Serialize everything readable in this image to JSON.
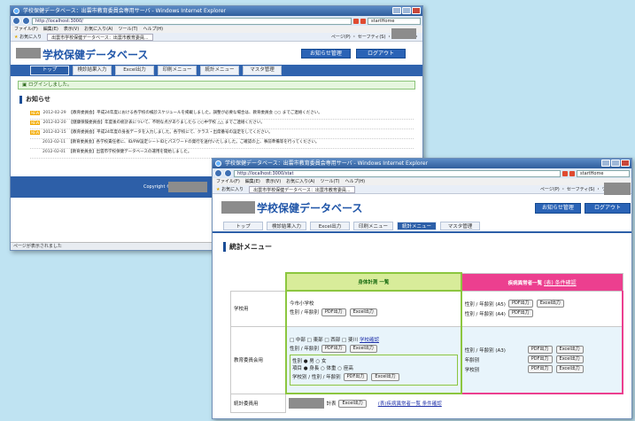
{
  "window1": {
    "title": "学校保健データベース：出雲市教育委員会専用サーバ - Windows Internet Explorer",
    "url": "http://localhost:3000/",
    "search_placeholder": "startHome",
    "menu": [
      "ファイル(F)",
      "編集(E)",
      "表示(V)",
      "お気に入り(A)",
      "ツール(T)",
      "ヘルプ(H)"
    ],
    "fav_label": "お気に入り",
    "fav_tab": "出雲市学校保健データベース：出雲市教育委員...",
    "toolbar_right": "ページ(P) ・ セーフティ(S) ・ ツール(O) ・",
    "site_title": "学校保健データベース",
    "header_buttons": [
      "お知らせ管理",
      "ログアウト"
    ],
    "nav_tabs": [
      "トップ",
      "検診結果入力",
      "Excel出力",
      "印刷メニュー",
      "統計メニュー",
      "マスタ管理"
    ],
    "login_message": "ログインしました。",
    "news_heading": "お知らせ",
    "news": [
      {
        "date": "2012-02-29",
        "text": "【教育委員会】平成24年度における各学校の検診スケジュールを掲載しました。調整が必要な場合は、教育委員会 ○○ までご連絡ください。"
      },
      {
        "date": "2012-02-20",
        "text": "【健康保険委員会】年度後の統計表について、不明な点がありましたら ○○中学校 △△ までご連絡ください。"
      },
      {
        "date": "2012-02-15",
        "text": "【教育委員会】平成24年度の身長データを入力しました。各学校にて、クラス・出席番号の設定をしてください。"
      },
      {
        "date": "2012-02-11",
        "text": "【教育委員会】各学校責任者に、ID/PW設定シートIDとパスワードの発行を送付いたしました。ご確認の上、事前準備等を行ってください。"
      },
      {
        "date": "2012-02-01",
        "text": "【教育委員会】出雲市学校保健データベースの運用を開始しました。"
      }
    ],
    "footer_copyright": "Copyright ©",
    "status_text": "ページが表示されました"
  },
  "window2": {
    "title": "学校保健データベース：出雲市教育委員会専用サーバ - Windows Internet Explorer",
    "url": "http://localhost:3000/stat",
    "search_placeholder": "startHome",
    "menu": [
      "ファイル(F)",
      "編集(E)",
      "表示(V)",
      "お気に入り(A)",
      "ツール(T)",
      "ヘルプ(H)"
    ],
    "fav_label": "お気に入り",
    "fav_tab": "出雲市学校保健データベース：出雲市教育委員...",
    "toolbar_right": "ページ(P) ・ セーフティ(S) ・ ツール(O) ・",
    "site_title": "学校保健データベース",
    "header_buttons": [
      "お知らせ管理",
      "ログアウト"
    ],
    "nav_tabs": [
      "トップ",
      "検診結果入力",
      "Excel出力",
      "印刷メニュー",
      "統計メニュー",
      "マスタ管理"
    ],
    "section_heading": "統計メニュー",
    "col_body": "身体計測 一覧",
    "col_disease": "疾病異常者一覧",
    "col_disease_link": "(表) 条件確認",
    "rows": {
      "school_label": "学校用",
      "school_name": "今市小学校",
      "board_label": "教育委員会用",
      "committee_label": "統計委員用"
    },
    "labels": {
      "sex_grade": "性別 / 年齢別",
      "sex_grade_a5": "性別 / 年齢別 (A5)",
      "sex_grade_a4": "性別 / 年齢別 (A4)",
      "sex_grade_a3": "性別 / 年齢別 (A3)",
      "grade": "年齢別",
      "school": "学校別",
      "school_sex_grade": "学校別 / 性別 / 年齢別",
      "sex_row": "性別 ● 男 ○ 女",
      "item_row": "項目 ● 身長 ○ 体重 ○ 座高",
      "areas": "□ 中部 □ 東部 □ 西部 □ 斐川",
      "school_confirm": "学校確認",
      "table_suffix": "計表",
      "disease_list_link": "(表)疾病異常者一覧 条件確認"
    },
    "buttons": {
      "pdf": "PDF出力",
      "excel": "Excel出力"
    }
  },
  "colors": {
    "brand_blue": "#2c5fa8",
    "green_border": "#8cc63f",
    "pink": "#ec3f8f"
  },
  "icons": [
    "ie-icon",
    "back-icon",
    "forward-icon",
    "refresh-icon",
    "stop-icon",
    "star-icon",
    "notice-icon"
  ]
}
